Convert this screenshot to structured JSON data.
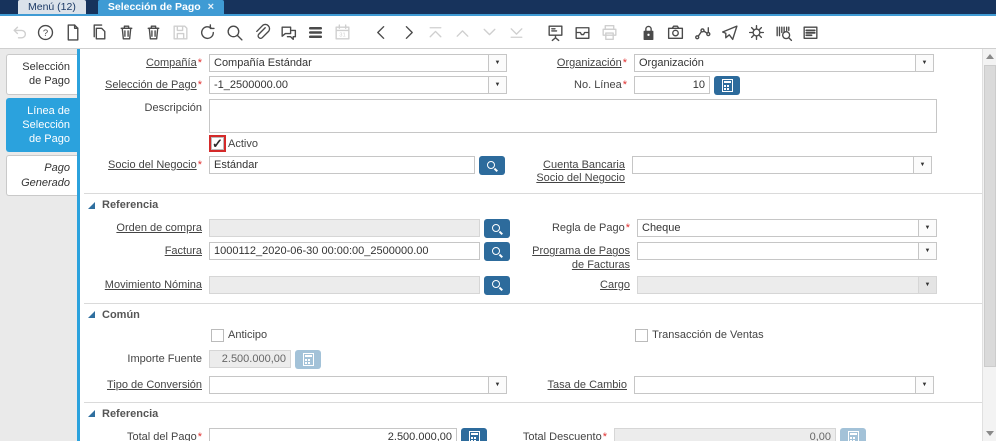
{
  "ui": {
    "required_marker": "*",
    "close_icon": "×"
  },
  "tabbar": {
    "menu_tab": "Menú (12)",
    "window_tab": "Selección de Pago"
  },
  "toolbar": {
    "icons": [
      {
        "name": "undo",
        "disabled": true
      },
      {
        "name": "help",
        "disabled": false
      },
      {
        "name": "new-record",
        "disabled": false
      },
      {
        "name": "copy-record",
        "disabled": false
      },
      {
        "name": "delete-record",
        "disabled": false
      },
      {
        "name": "delete-selection",
        "disabled": false
      },
      {
        "name": "save",
        "disabled": true
      },
      {
        "name": "refresh",
        "disabled": false
      },
      {
        "name": "find",
        "disabled": false
      },
      {
        "name": "attachment",
        "disabled": false
      },
      {
        "name": "chat",
        "disabled": false
      },
      {
        "name": "grid-toggle",
        "disabled": false
      },
      {
        "name": "calendar",
        "disabled": true
      },
      {
        "name": "prev-record",
        "disabled": false,
        "gap": true
      },
      {
        "name": "next-record",
        "disabled": false
      },
      {
        "name": "first-record",
        "disabled": true
      },
      {
        "name": "up-record",
        "disabled": true
      },
      {
        "name": "down-record",
        "disabled": true
      },
      {
        "name": "last-record",
        "disabled": true
      },
      {
        "name": "report",
        "disabled": false,
        "gap": true
      },
      {
        "name": "archive",
        "disabled": false
      },
      {
        "name": "print",
        "disabled": true
      },
      {
        "name": "lock",
        "disabled": false,
        "gap": true
      },
      {
        "name": "zoom-across",
        "disabled": false
      },
      {
        "name": "workflow",
        "disabled": false
      },
      {
        "name": "requests",
        "disabled": false
      },
      {
        "name": "process",
        "disabled": false
      },
      {
        "name": "product-info",
        "disabled": false
      },
      {
        "name": "window-customization",
        "disabled": false
      }
    ]
  },
  "sidebar": {
    "tabs": [
      {
        "id": "seleccion-de-pago",
        "label": "Selección de Pago",
        "active": false,
        "italic": false
      },
      {
        "id": "linea-de-seleccion-de-pago",
        "label": "Línea de Selección de Pago",
        "active": true,
        "italic": false
      },
      {
        "id": "pago-generado",
        "label": "Pago Generado",
        "active": false,
        "italic": true
      }
    ]
  },
  "form": {
    "sections": {
      "referencia": "Referencia",
      "comun": "Común",
      "referencia2": "Referencia"
    },
    "fields": {
      "compania": {
        "label": "Compañía",
        "value": "Compañía Estándar"
      },
      "organizacion": {
        "label": "Organización",
        "value": "Organización"
      },
      "seleccion_de_pago": {
        "label": "Selección de Pago",
        "value": "-1_2500000.00"
      },
      "no_linea": {
        "label": "No. Línea",
        "value": "10"
      },
      "descripcion": {
        "label": "Descripción",
        "value": ""
      },
      "activo": {
        "label": "Activo",
        "checked": true
      },
      "socio": {
        "label": "Socio del Negocio",
        "value": "Estándar"
      },
      "cuenta_bancaria": {
        "label": "Cuenta Bancaria Socio del Negocio",
        "value": ""
      },
      "orden_compra": {
        "label": "Orden de compra",
        "value": ""
      },
      "regla_pago": {
        "label": "Regla de Pago",
        "value": "Cheque"
      },
      "factura": {
        "label": "Factura",
        "value": "1000112_2020-06-30 00:00:00_2500000.00"
      },
      "programa_pagos": {
        "label": "Programa de Pagos de Facturas",
        "value": ""
      },
      "movimiento_nomina": {
        "label": "Movimiento Nómina",
        "value": ""
      },
      "cargo": {
        "label": "Cargo",
        "value": ""
      },
      "anticipo": {
        "label": "Anticipo",
        "checked": false
      },
      "transaccion_ventas": {
        "label": "Transacción de Ventas",
        "checked": false
      },
      "importe_fuente": {
        "label": "Importe Fuente",
        "value": "2.500.000,00"
      },
      "tipo_conversion": {
        "label": "Tipo de Conversión",
        "value": ""
      },
      "tasa_cambio": {
        "label": "Tasa de Cambio",
        "value": ""
      },
      "total_pago": {
        "label": "Total del Pago",
        "value": "2.500.000,00"
      },
      "total_descuento": {
        "label": "Total Descuento",
        "value": "0,00"
      }
    }
  }
}
